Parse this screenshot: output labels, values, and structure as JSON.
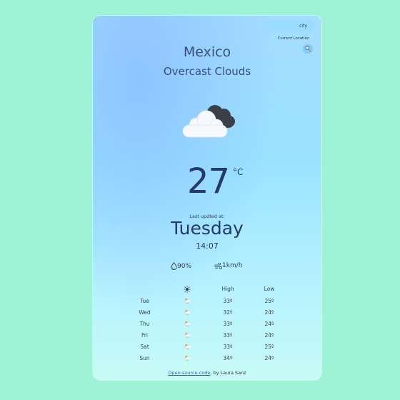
{
  "search": {
    "placeholder": "city",
    "current_location_label": "Current Location",
    "search_icon": "magnifier-icon"
  },
  "current": {
    "city": "Mexico",
    "description": "Overcast Clouds",
    "icon": "overcast-clouds-icon",
    "temperature": "27",
    "unit": "°C",
    "last_updated_label": "Last updted at:",
    "day": "Tuesday",
    "time": "14:07",
    "humidity": "90%",
    "humidity_icon": "droplet-icon",
    "wind": "1km/h",
    "wind_icon": "wind-icon"
  },
  "forecast": {
    "header_icon": "sun-icon",
    "high_label": "High",
    "low_label": "Low",
    "days": [
      {
        "day": "Tue",
        "icon": "sun-rain-icon",
        "high": "33º",
        "low": "25º"
      },
      {
        "day": "Wed",
        "icon": "sun-rain-icon",
        "high": "32º",
        "low": "24º"
      },
      {
        "day": "Thu",
        "icon": "sun-rain-icon",
        "high": "33º",
        "low": "24º"
      },
      {
        "day": "Fri",
        "icon": "sun-rain-icon",
        "high": "33º",
        "low": "24º"
      },
      {
        "day": "Sat",
        "icon": "sun-rain-icon",
        "high": "33º",
        "low": "25º"
      },
      {
        "day": "Sun",
        "icon": "sun-rain-icon",
        "high": "34º",
        "low": "24º"
      }
    ]
  },
  "footer": {
    "link_text": "Open-source code",
    "suffix": ", by Laura Sanz"
  }
}
